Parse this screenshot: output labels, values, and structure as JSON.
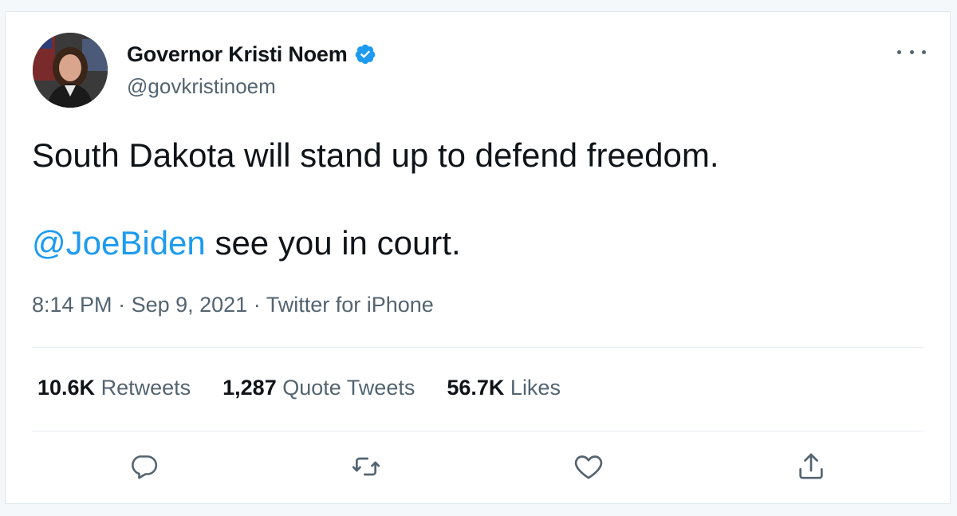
{
  "tweet": {
    "display_name": "Governor Kristi Noem",
    "handle": "@govkristinoem",
    "text_line1": "South Dakota will stand up to defend freedom.",
    "mention": "@JoeBiden",
    "text_line2_rest": " see you in court.",
    "time": "8:14 PM",
    "date": "Sep 9, 2021",
    "source": "Twitter for iPhone",
    "separator": " · "
  },
  "stats": {
    "retweets_count": "10.6K",
    "retweets_label": "Retweets",
    "quotes_count": "1,287",
    "quotes_label": "Quote Tweets",
    "likes_count": "56.7K",
    "likes_label": "Likes"
  },
  "icons": {
    "verified": "verified-badge-icon",
    "more": "more-options-icon",
    "reply": "reply-icon",
    "retweet": "retweet-icon",
    "like": "heart-icon",
    "share": "share-icon"
  },
  "colors": {
    "accent": "#1d9bf0",
    "text": "#0f1419",
    "secondary": "#536471",
    "divider": "#e6ecf0"
  }
}
